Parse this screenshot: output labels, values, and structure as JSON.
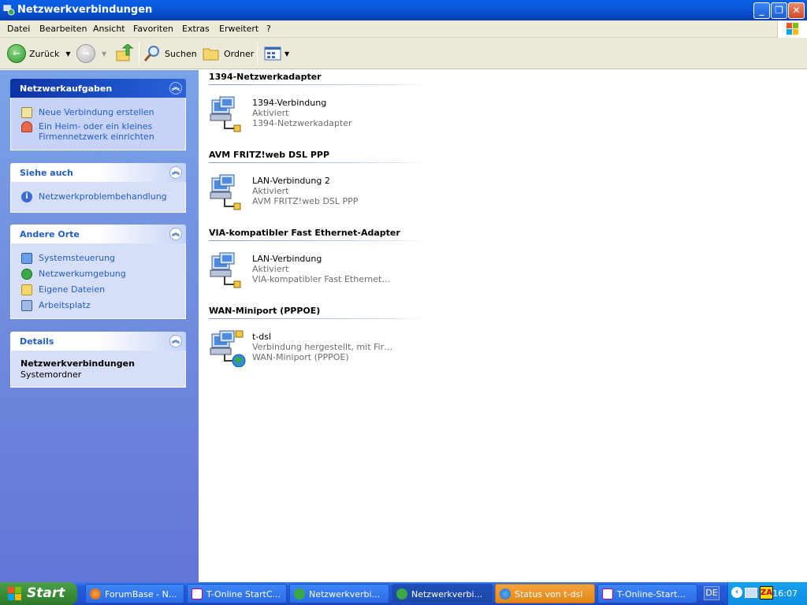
{
  "window": {
    "title": "Netzwerkverbindungen"
  },
  "menu": [
    "Datei",
    "Bearbeiten",
    "Ansicht",
    "Favoriten",
    "Extras",
    "Erweitert",
    "?"
  ],
  "toolbar": {
    "back": "Zurück",
    "search": "Suchen",
    "folders": "Ordner"
  },
  "sidebar": {
    "tasks": {
      "title": "Netzwerkaufgaben",
      "items": [
        "Neue Verbindung erstellen",
        "Ein Heim- oder ein kleines Firmennetzwerk einrichten"
      ]
    },
    "see_also": {
      "title": "Siehe auch",
      "items": [
        "Netzwerkproblembehandlung"
      ]
    },
    "places": {
      "title": "Andere Orte",
      "items": [
        "Systemsteuerung",
        "Netzwerkumgebung",
        "Eigene Dateien",
        "Arbeitsplatz"
      ]
    },
    "details": {
      "title": "Details",
      "name": "Netzwerkverbindungen",
      "type": "Systemordner"
    }
  },
  "groups": [
    {
      "title": "1394-Netzwerkadapter",
      "item": {
        "name": "1394-Verbindung",
        "status": "Aktiviert",
        "device": "1394-Netzwerkadapter"
      }
    },
    {
      "title": "AVM FRITZ!web DSL PPP",
      "item": {
        "name": "LAN-Verbindung 2",
        "status": "Aktiviert",
        "device": "AVM FRITZ!web DSL PPP"
      }
    },
    {
      "title": "VIA-kompatibler Fast Ethernet-Adapter",
      "item": {
        "name": "LAN-Verbindung",
        "status": "Aktiviert",
        "device": "VIA-kompatibler Fast Ethernet…"
      }
    },
    {
      "title": "WAN-Miniport (PPPOE)",
      "item": {
        "name": "t-dsl",
        "status": "Verbindung hergestellt, mit Fir…",
        "device": "WAN-Miniport (PPPOE)"
      }
    }
  ],
  "taskbar": {
    "start": "Start",
    "tasks": [
      "ForumBase - N...",
      "T-Online StartC...",
      "Netzwerkverbi...",
      "Netzwerkverbi...",
      "Status von t-dsl",
      "T-Online-Start..."
    ],
    "lang": "DE",
    "clock": "16:07"
  },
  "colors": {
    "accent": "#215dc6",
    "titlebar": "#0a58d8",
    "sidebar": "#6375d6",
    "taskbar": "#245edc",
    "start": "#3a8c37"
  }
}
